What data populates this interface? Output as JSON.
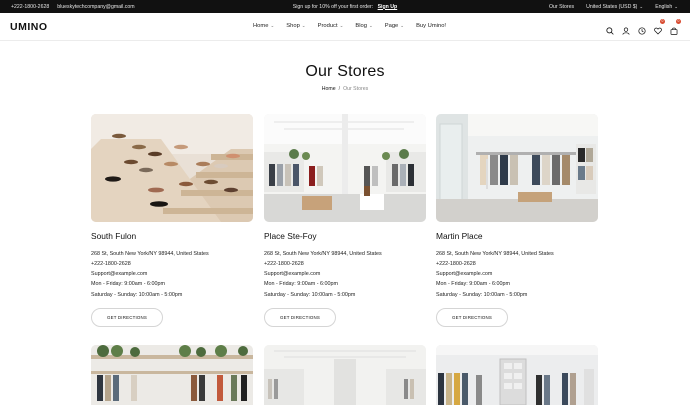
{
  "topbar": {
    "phone": "+222-1800-2628",
    "email": "blueskytechcompany@gmail.com",
    "promo": "Sign up for 10% off your first order:",
    "promo_link": "Sign Up",
    "our_stores": "Our Stores",
    "currency": "United States (USD $)",
    "language": "English"
  },
  "header": {
    "logo": "UMINO",
    "nav": [
      "Home",
      "Shop",
      "Product",
      "Blog",
      "Page",
      "Buy Umino!"
    ],
    "wishlist_count": "0",
    "cart_count": "0"
  },
  "page": {
    "title": "Our Stores",
    "breadcrumb_home": "Home",
    "breadcrumb_sep": "/",
    "breadcrumb_current": "Our Stores"
  },
  "stores": [
    {
      "name": "South Fulon",
      "address": "268 St, South New York/NY 98944, United States",
      "phone": "+222-1800-2628",
      "email": "Support@example.com",
      "weekday_hours": "Mon - Friday: 9:00am - 6:00pm",
      "weekend_hours": "Saturday - Sunday: 10:00am - 5:00pm",
      "button": "GET DIRECTIONS"
    },
    {
      "name": "Place Ste-Foy",
      "address": "268 St, South New York/NY 98944, United States",
      "phone": "+222-1800-2628",
      "email": "Support@example.com",
      "weekday_hours": "Mon - Friday: 9:00am - 6:00pm",
      "weekend_hours": "Saturday - Sunday: 10:00am - 5:00pm",
      "button": "GET DIRECTIONS"
    },
    {
      "name": "Martin Place",
      "address": "268 St, South New York/NY 98944, United States",
      "phone": "+222-1800-2628",
      "email": "Support@example.com",
      "weekday_hours": "Mon - Friday: 9:00am - 6:00pm",
      "weekend_hours": "Saturday - Sunday: 10:00am - 5:00pm",
      "button": "GET DIRECTIONS"
    }
  ],
  "icons": {
    "search": "search-icon",
    "account": "user-icon",
    "compare": "compare-icon",
    "wishlist": "heart-icon",
    "cart": "bag-icon"
  },
  "colors": {
    "topbar_bg": "#111111",
    "badge": "#d84a2f",
    "text": "#111111"
  }
}
